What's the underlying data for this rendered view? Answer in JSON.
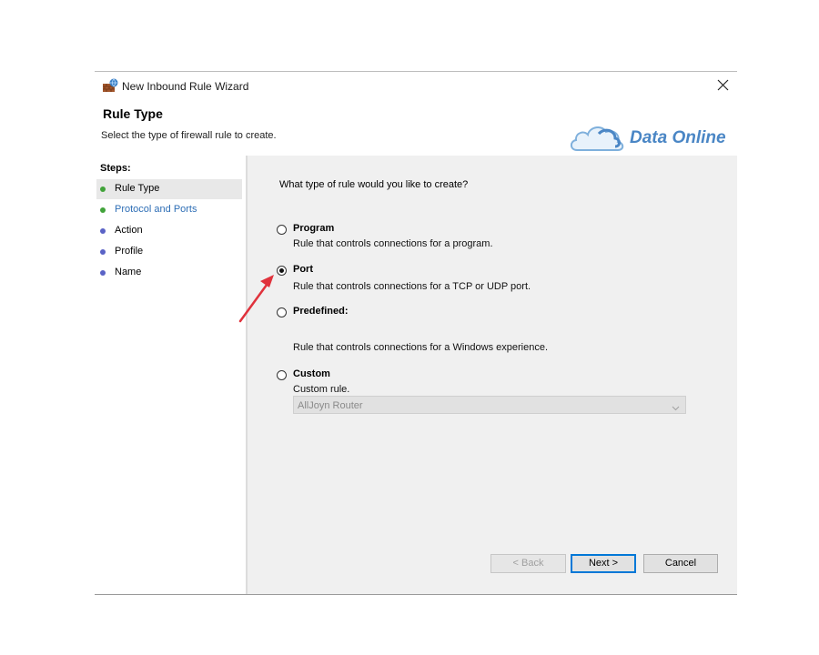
{
  "window": {
    "title": "New Inbound Rule Wizard",
    "page_title": "Rule Type",
    "page_subtitle": "Select the type of firewall rule to create.",
    "logo_text": "Data Online"
  },
  "steps": {
    "label": "Steps:",
    "items": [
      {
        "label": "Rule Type",
        "state": "current"
      },
      {
        "label": "Protocol and Ports",
        "state": "done-link"
      },
      {
        "label": "Action",
        "state": "pending"
      },
      {
        "label": "Profile",
        "state": "pending"
      },
      {
        "label": "Name",
        "state": "pending"
      }
    ]
  },
  "content": {
    "question": "What type of rule would you like to create?",
    "options": [
      {
        "label": "Program",
        "description": "Rule that controls connections for a program.",
        "checked": false
      },
      {
        "label": "Port",
        "description": "Rule that controls connections for a TCP or UDP port.",
        "checked": true
      },
      {
        "label": "Predefined:",
        "description": "Rule that controls connections for a Windows experience.",
        "checked": false
      },
      {
        "label": "Custom",
        "description": "Custom rule.",
        "checked": false
      }
    ],
    "predefined_dropdown": {
      "value": "AllJoyn Router"
    }
  },
  "buttons": {
    "back": "< Back",
    "next": "Next >",
    "cancel": "Cancel"
  },
  "colors": {
    "accent": "#0078d7",
    "annotation_arrow": "#e0323c",
    "logo": "#4a86c5"
  }
}
